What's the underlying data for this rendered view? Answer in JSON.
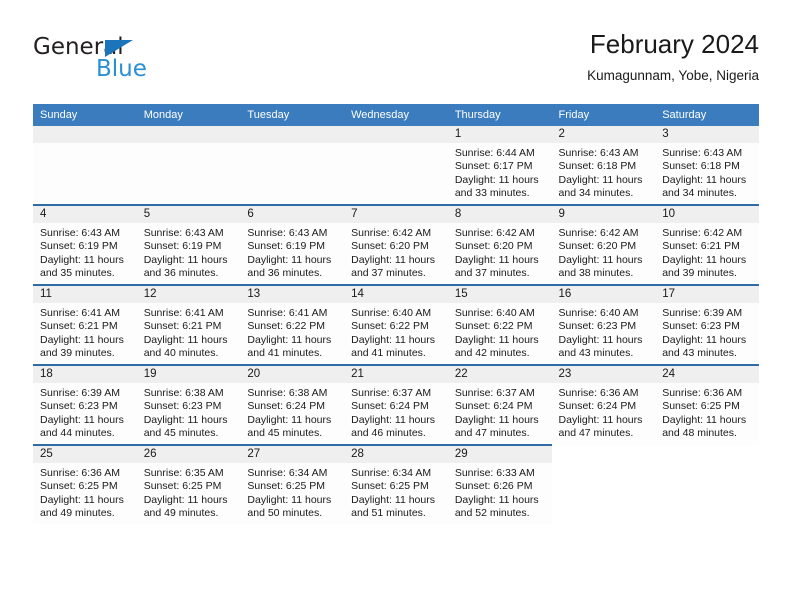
{
  "brand": {
    "name_part1": "General",
    "name_part2": "Blue",
    "triangle_color": "#1b75bb",
    "blue_color": "#2a8fd4"
  },
  "header": {
    "title": "February 2024",
    "subtitle": "Kumagunnam, Yobe, Nigeria"
  },
  "theme": {
    "header_bg": "#3a7cbe",
    "row_border": "#2d6da4",
    "daynum_band": "#efefef"
  },
  "weekdays": [
    "Sunday",
    "Monday",
    "Tuesday",
    "Wednesday",
    "Thursday",
    "Friday",
    "Saturday"
  ],
  "labels": {
    "sunrise_prefix": "Sunrise:",
    "sunset_prefix": "Sunset:",
    "daylight_prefix": "Daylight:"
  },
  "weeks": [
    [
      {
        "day": "",
        "sunrise": "",
        "sunset": "",
        "daylight_line1": "",
        "daylight_line2": ""
      },
      {
        "day": "",
        "sunrise": "",
        "sunset": "",
        "daylight_line1": "",
        "daylight_line2": ""
      },
      {
        "day": "",
        "sunrise": "",
        "sunset": "",
        "daylight_line1": "",
        "daylight_line2": ""
      },
      {
        "day": "",
        "sunrise": "",
        "sunset": "",
        "daylight_line1": "",
        "daylight_line2": ""
      },
      {
        "day": "1",
        "sunrise": "Sunrise: 6:44 AM",
        "sunset": "Sunset: 6:17 PM",
        "daylight_line1": "Daylight: 11 hours",
        "daylight_line2": "and 33 minutes."
      },
      {
        "day": "2",
        "sunrise": "Sunrise: 6:43 AM",
        "sunset": "Sunset: 6:18 PM",
        "daylight_line1": "Daylight: 11 hours",
        "daylight_line2": "and 34 minutes."
      },
      {
        "day": "3",
        "sunrise": "Sunrise: 6:43 AM",
        "sunset": "Sunset: 6:18 PM",
        "daylight_line1": "Daylight: 11 hours",
        "daylight_line2": "and 34 minutes."
      }
    ],
    [
      {
        "day": "4",
        "sunrise": "Sunrise: 6:43 AM",
        "sunset": "Sunset: 6:19 PM",
        "daylight_line1": "Daylight: 11 hours",
        "daylight_line2": "and 35 minutes."
      },
      {
        "day": "5",
        "sunrise": "Sunrise: 6:43 AM",
        "sunset": "Sunset: 6:19 PM",
        "daylight_line1": "Daylight: 11 hours",
        "daylight_line2": "and 36 minutes."
      },
      {
        "day": "6",
        "sunrise": "Sunrise: 6:43 AM",
        "sunset": "Sunset: 6:19 PM",
        "daylight_line1": "Daylight: 11 hours",
        "daylight_line2": "and 36 minutes."
      },
      {
        "day": "7",
        "sunrise": "Sunrise: 6:42 AM",
        "sunset": "Sunset: 6:20 PM",
        "daylight_line1": "Daylight: 11 hours",
        "daylight_line2": "and 37 minutes."
      },
      {
        "day": "8",
        "sunrise": "Sunrise: 6:42 AM",
        "sunset": "Sunset: 6:20 PM",
        "daylight_line1": "Daylight: 11 hours",
        "daylight_line2": "and 37 minutes."
      },
      {
        "day": "9",
        "sunrise": "Sunrise: 6:42 AM",
        "sunset": "Sunset: 6:20 PM",
        "daylight_line1": "Daylight: 11 hours",
        "daylight_line2": "and 38 minutes."
      },
      {
        "day": "10",
        "sunrise": "Sunrise: 6:42 AM",
        "sunset": "Sunset: 6:21 PM",
        "daylight_line1": "Daylight: 11 hours",
        "daylight_line2": "and 39 minutes."
      }
    ],
    [
      {
        "day": "11",
        "sunrise": "Sunrise: 6:41 AM",
        "sunset": "Sunset: 6:21 PM",
        "daylight_line1": "Daylight: 11 hours",
        "daylight_line2": "and 39 minutes."
      },
      {
        "day": "12",
        "sunrise": "Sunrise: 6:41 AM",
        "sunset": "Sunset: 6:21 PM",
        "daylight_line1": "Daylight: 11 hours",
        "daylight_line2": "and 40 minutes."
      },
      {
        "day": "13",
        "sunrise": "Sunrise: 6:41 AM",
        "sunset": "Sunset: 6:22 PM",
        "daylight_line1": "Daylight: 11 hours",
        "daylight_line2": "and 41 minutes."
      },
      {
        "day": "14",
        "sunrise": "Sunrise: 6:40 AM",
        "sunset": "Sunset: 6:22 PM",
        "daylight_line1": "Daylight: 11 hours",
        "daylight_line2": "and 41 minutes."
      },
      {
        "day": "15",
        "sunrise": "Sunrise: 6:40 AM",
        "sunset": "Sunset: 6:22 PM",
        "daylight_line1": "Daylight: 11 hours",
        "daylight_line2": "and 42 minutes."
      },
      {
        "day": "16",
        "sunrise": "Sunrise: 6:40 AM",
        "sunset": "Sunset: 6:23 PM",
        "daylight_line1": "Daylight: 11 hours",
        "daylight_line2": "and 43 minutes."
      },
      {
        "day": "17",
        "sunrise": "Sunrise: 6:39 AM",
        "sunset": "Sunset: 6:23 PM",
        "daylight_line1": "Daylight: 11 hours",
        "daylight_line2": "and 43 minutes."
      }
    ],
    [
      {
        "day": "18",
        "sunrise": "Sunrise: 6:39 AM",
        "sunset": "Sunset: 6:23 PM",
        "daylight_line1": "Daylight: 11 hours",
        "daylight_line2": "and 44 minutes."
      },
      {
        "day": "19",
        "sunrise": "Sunrise: 6:38 AM",
        "sunset": "Sunset: 6:23 PM",
        "daylight_line1": "Daylight: 11 hours",
        "daylight_line2": "and 45 minutes."
      },
      {
        "day": "20",
        "sunrise": "Sunrise: 6:38 AM",
        "sunset": "Sunset: 6:24 PM",
        "daylight_line1": "Daylight: 11 hours",
        "daylight_line2": "and 45 minutes."
      },
      {
        "day": "21",
        "sunrise": "Sunrise: 6:37 AM",
        "sunset": "Sunset: 6:24 PM",
        "daylight_line1": "Daylight: 11 hours",
        "daylight_line2": "and 46 minutes."
      },
      {
        "day": "22",
        "sunrise": "Sunrise: 6:37 AM",
        "sunset": "Sunset: 6:24 PM",
        "daylight_line1": "Daylight: 11 hours",
        "daylight_line2": "and 47 minutes."
      },
      {
        "day": "23",
        "sunrise": "Sunrise: 6:36 AM",
        "sunset": "Sunset: 6:24 PM",
        "daylight_line1": "Daylight: 11 hours",
        "daylight_line2": "and 47 minutes."
      },
      {
        "day": "24",
        "sunrise": "Sunrise: 6:36 AM",
        "sunset": "Sunset: 6:25 PM",
        "daylight_line1": "Daylight: 11 hours",
        "daylight_line2": "and 48 minutes."
      }
    ],
    [
      {
        "day": "25",
        "sunrise": "Sunrise: 6:36 AM",
        "sunset": "Sunset: 6:25 PM",
        "daylight_line1": "Daylight: 11 hours",
        "daylight_line2": "and 49 minutes."
      },
      {
        "day": "26",
        "sunrise": "Sunrise: 6:35 AM",
        "sunset": "Sunset: 6:25 PM",
        "daylight_line1": "Daylight: 11 hours",
        "daylight_line2": "and 49 minutes."
      },
      {
        "day": "27",
        "sunrise": "Sunrise: 6:34 AM",
        "sunset": "Sunset: 6:25 PM",
        "daylight_line1": "Daylight: 11 hours",
        "daylight_line2": "and 50 minutes."
      },
      {
        "day": "28",
        "sunrise": "Sunrise: 6:34 AM",
        "sunset": "Sunset: 6:25 PM",
        "daylight_line1": "Daylight: 11 hours",
        "daylight_line2": "and 51 minutes."
      },
      {
        "day": "29",
        "sunrise": "Sunrise: 6:33 AM",
        "sunset": "Sunset: 6:26 PM",
        "daylight_line1": "Daylight: 11 hours",
        "daylight_line2": "and 52 minutes."
      },
      {
        "day": "",
        "sunrise": "",
        "sunset": "",
        "daylight_line1": "",
        "daylight_line2": ""
      },
      {
        "day": "",
        "sunrise": "",
        "sunset": "",
        "daylight_line1": "",
        "daylight_line2": ""
      }
    ]
  ]
}
